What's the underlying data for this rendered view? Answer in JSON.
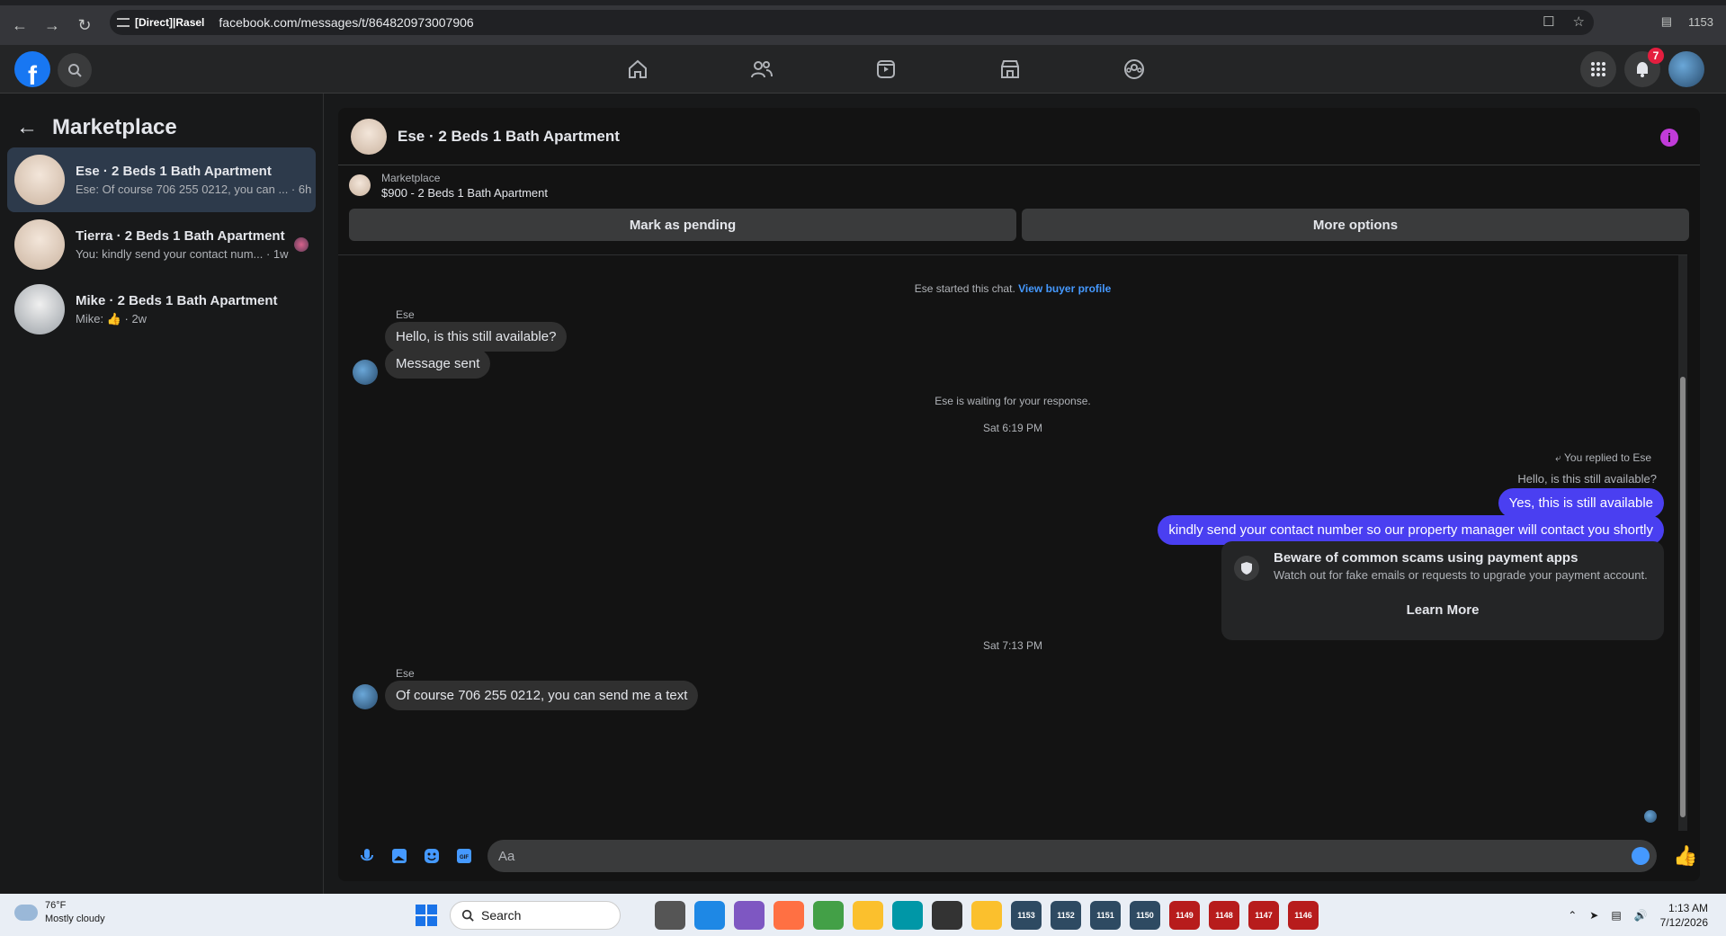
{
  "browser": {
    "site_chip": "[Direct]|Rasel",
    "url": "facebook.com/messages/t/864820973007906",
    "tab_count": "1153"
  },
  "fbnav": {
    "logo": "f",
    "notification_count": "7"
  },
  "sidebar": {
    "title": "Marketplace",
    "conversations": [
      {
        "title": "Ese · 2 Beds 1 Bath Apartment",
        "preview": "Ese: Of course 706 255 0212, you can ... · 6h"
      },
      {
        "title": "Tierra · 2 Beds 1 Bath Apartment",
        "preview": "You: kindly send your contact num... · 1w"
      },
      {
        "title": "Mike · 2 Beds 1 Bath Apartment",
        "preview_prefix": "Mike:",
        "preview_suffix": "· 2w"
      }
    ]
  },
  "chat": {
    "header_title": "Ese · 2 Beds 1 Bath Apartment",
    "listing_label": "Marketplace",
    "listing_title": "$900 - 2 Beds 1 Bath Apartment",
    "mark_pending": "Mark as pending",
    "more_options": "More options",
    "started_note": "Ese started this chat.",
    "view_profile": "View buyer profile",
    "sender_name": "Ese",
    "msg1": "Hello, is this still available?",
    "msg2": "Message sent",
    "waiting_note": "Ese is waiting for your response.",
    "time1": "Sat 6:19 PM",
    "replied_to": "You replied to Ese",
    "quoted": "Hello, is this still available?",
    "out1": "Yes, this is still available",
    "out2": "kindly send your contact number so our property manager will contact you shortly",
    "scam_title": "Beware of common scams using payment apps",
    "scam_sub": "Watch out for fake emails or requests to upgrade your payment account.",
    "learn_more": "Learn More",
    "time2": "Sat 7:13 PM",
    "sender_name2": "Ese",
    "msg3": "Of course 706 255 0212, you can send me a text",
    "composer_placeholder": "Aa"
  },
  "taskbar": {
    "temp": "76°F",
    "weather": "Mostly cloudy",
    "search": "Search",
    "apps": [
      "1153",
      "1152",
      "1151",
      "1150",
      "1149",
      "1148",
      "1147",
      "1146"
    ],
    "time": "1:13 AM",
    "date": "7/12/2026"
  }
}
